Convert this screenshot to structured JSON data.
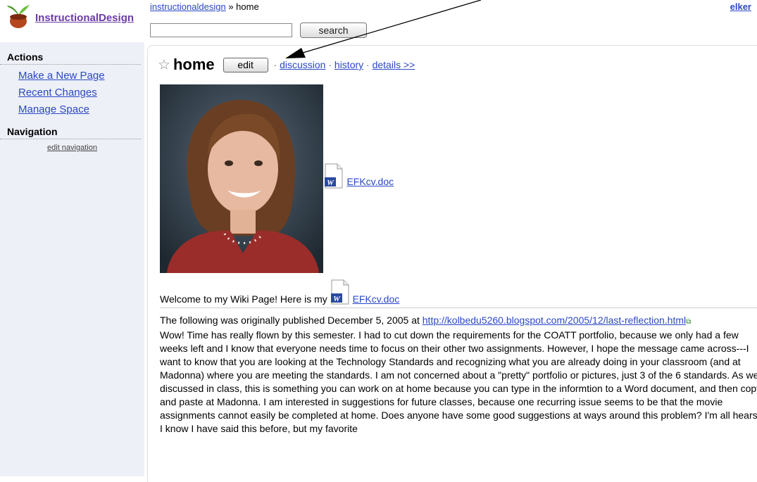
{
  "header": {
    "space_name": "InstructionalDesign",
    "breadcrumb_link": "instructionaldesign",
    "breadcrumb_sep": "»",
    "breadcrumb_current": "home",
    "search_value": "",
    "search_button": "search",
    "user": "elker"
  },
  "sidebar": {
    "actions_heading": "Actions",
    "actions": [
      "Make a New Page",
      "Recent Changes",
      "Manage Space"
    ],
    "navigation_heading": "Navigation",
    "edit_navigation": "edit navigation"
  },
  "page": {
    "title": "home",
    "edit_label": "edit",
    "tabs": [
      "discussion",
      "history",
      "details >>"
    ],
    "attachment_1": "EFKcv.doc",
    "welcome_text": "Welcome to my Wiki Page! Here is my",
    "attachment_2": "EFKcv.doc",
    "intro": "The following was originally published December 5, 2005 at",
    "intro_link": "http://kolbedu5260.blogspot.com/2005/12/last-reflection.html",
    "body": "Wow! Time has really flown by this semester. I had to cut down the requirements for the COATT portfolio, because we only had a few weeks left and I know that everyone needs time to focus on their other two assignments. However, I hope the message came across---I want to know that you are looking at the Technology Standards and recognizing what you are already doing in your classroom (and at Madonna) where you are meeting the standards. I am not concerned about a \"pretty\" portfolio or pictures, just 3 of the 6 standards. As we discussed in class, this is something you can work on at home because you can type in the informtion to a Word document, and then copy and paste at Madonna. I am interested in suggestions for future classes, because one recurring issue seems to be that the movie assignments cannot easily be completed at home. Does anyone have some good suggestions at ways around this problem? I'm all hears. I know I have said this before, but my favorite"
  },
  "colors": {
    "link": "#2b48c2",
    "space_name": "#6b3aa6",
    "sidebar_bg": "#eef0f8"
  },
  "icons": [
    "star-icon",
    "word-doc-icon",
    "external-link-icon",
    "logo-plant-icon",
    "annotation-arrow"
  ]
}
